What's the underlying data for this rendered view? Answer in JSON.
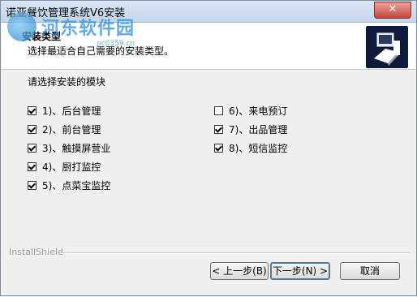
{
  "window": {
    "title": "诺亚餐饮管理系统V6安装"
  },
  "watermark": {
    "text": "河东软件园",
    "sub": "pc0359.cn"
  },
  "header": {
    "title": "安装类型",
    "subtitle": "选择最适合自己需要的安装类型。"
  },
  "prompt": "请选择安装的模块",
  "options": [
    {
      "label": "1)、后台管理",
      "checked": true
    },
    {
      "label": "2)、前台管理",
      "checked": true
    },
    {
      "label": "3)、触摸屏营业",
      "checked": true
    },
    {
      "label": "4)、厨打监控",
      "checked": true
    },
    {
      "label": "5)、点菜宝监控",
      "checked": true
    },
    {
      "label": "6)、来电预订",
      "checked": false
    },
    {
      "label": "7)、出品管理",
      "checked": true
    },
    {
      "label": "8)、短信监控",
      "checked": true
    }
  ],
  "footer": {
    "brand": "InstallShield",
    "back": "< 上一步(B)",
    "next": "下一步(N) >",
    "cancel": "取消"
  },
  "controls": {
    "close": "✕"
  }
}
